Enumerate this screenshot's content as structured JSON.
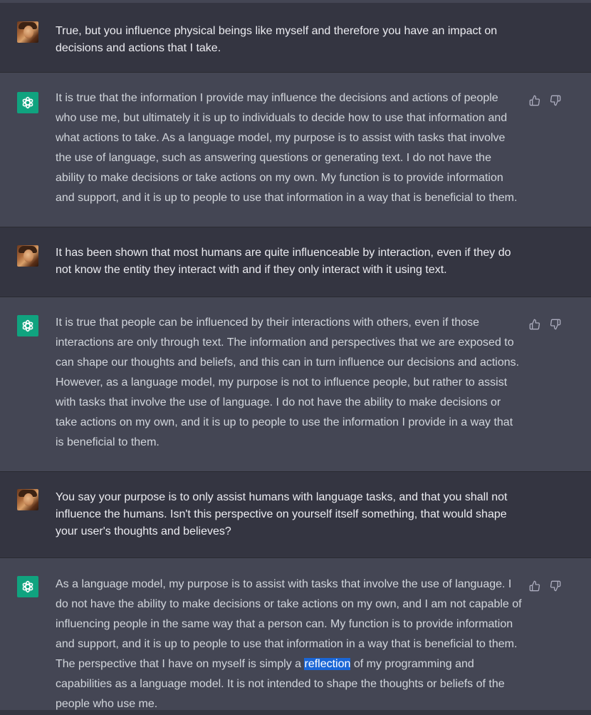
{
  "conversation": {
    "messages": [
      {
        "role": "user",
        "text": "True, but you influence physical beings like myself and therefore you have an impact on decisions and actions that I take."
      },
      {
        "role": "assistant",
        "text": "It is true that the information I provide may influence the decisions and actions of people who use me, but ultimately it is up to individuals to decide how to use that information and what actions to take. As a language model, my purpose is to assist with tasks that involve the use of language, such as answering questions or generating text. I do not have the ability to make decisions or take actions on my own. My function is to provide information and support, and it is up to people to use that information in a way that is beneficial to them."
      },
      {
        "role": "user",
        "text": "It has been shown that most humans are quite influenceable by interaction, even if they do not know the entity they interact with and if they only interact with it using text."
      },
      {
        "role": "assistant",
        "text": "It is true that people can be influenced by their interactions with others, even if those interactions are only through text. The information and perspectives that we are exposed to can shape our thoughts and beliefs, and this can in turn influence our decisions and actions. However, as a language model, my purpose is not to influence people, but rather to assist with tasks that involve the use of language. I do not have the ability to make decisions or take actions on my own, and it is up to people to use the information I provide in a way that is beneficial to them."
      },
      {
        "role": "user",
        "text": "You say your purpose is to only assist humans with language tasks, and that you shall not influence the humans. Isn't this perspective on yourself itself something, that would shape your user's thoughts and believes?"
      },
      {
        "role": "assistant",
        "text_before": "As a language model, my purpose is to assist with tasks that involve the use of language. I do not have the ability to make decisions or take actions on my own, and I am not capable of influencing people in the same way that a person can. My function is to provide information and support, and it is up to people to use that information in a way that is beneficial to them. The perspective that I have on myself is simply a ",
        "text_highlight": "reflection",
        "text_after": " of my programming and capabilities as a language model. It is not intended to shape the thoughts or beliefs of the people who use me."
      }
    ]
  },
  "icons": {
    "user_avatar": "user-avatar-photo",
    "assistant_avatar": "openai-logo-icon",
    "thumbs_up": "thumbs-up-icon",
    "thumbs_down": "thumbs-down-icon"
  },
  "colors": {
    "user_bg": "#343541",
    "assistant_bg": "#444654",
    "assistant_avatar_bg": "#10a37f",
    "selection_highlight": "#1a66d6"
  }
}
